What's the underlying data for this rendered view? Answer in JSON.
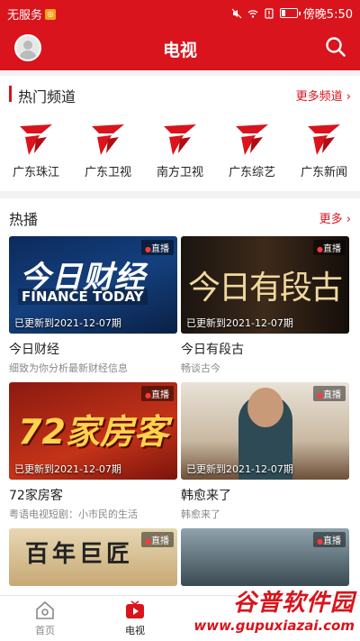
{
  "status_bar": {
    "carrier": "无服务",
    "time": "傍晚5:50",
    "battery_level": 0.25
  },
  "header": {
    "title": "电视"
  },
  "channels_section": {
    "title": "热门频道",
    "more": "更多频道",
    "items": [
      {
        "label": "广东珠江",
        "icon": "gdtv-logo-icon"
      },
      {
        "label": "广东卫视",
        "icon": "gdtv-logo-icon"
      },
      {
        "label": "南方卫视",
        "icon": "gdtv-logo-icon"
      },
      {
        "label": "广东综艺",
        "icon": "gdtv-logo-icon"
      },
      {
        "label": "广东新闻",
        "icon": "gdtv-logo-icon"
      }
    ]
  },
  "hot_section": {
    "title": "热播",
    "more": "更多",
    "live_label": "直播",
    "shows": [
      {
        "name": "今日财经",
        "desc": "细致为你分析最新财经信息",
        "update": "已更新到2021-12-07期",
        "art_text": "今日财经",
        "art_sub": "FINANCE TODAY"
      },
      {
        "name": "今日有段古",
        "desc": "畅谈古今",
        "update": "已更新到2021-12-07期",
        "art_text": "今日有段古"
      },
      {
        "name": "72家房客",
        "desc": "粤语电视短剧：小市民的生活",
        "update": "已更新到2021-12-07期",
        "art_text": "72家房客"
      },
      {
        "name": "韩愈来了",
        "desc": "韩愈来了",
        "update": "已更新到2021-12-07期"
      },
      {
        "art_text": "百年巨匠"
      },
      {}
    ]
  },
  "bottom_nav": {
    "items": [
      {
        "label": "首页",
        "icon": "home-icon"
      },
      {
        "label": "电视",
        "icon": "tv-play-icon"
      }
    ]
  },
  "watermark": {
    "main": "谷普软件园",
    "url": "www.gupuxiazai.com"
  },
  "colors": {
    "brand_red": "#d9141c"
  }
}
